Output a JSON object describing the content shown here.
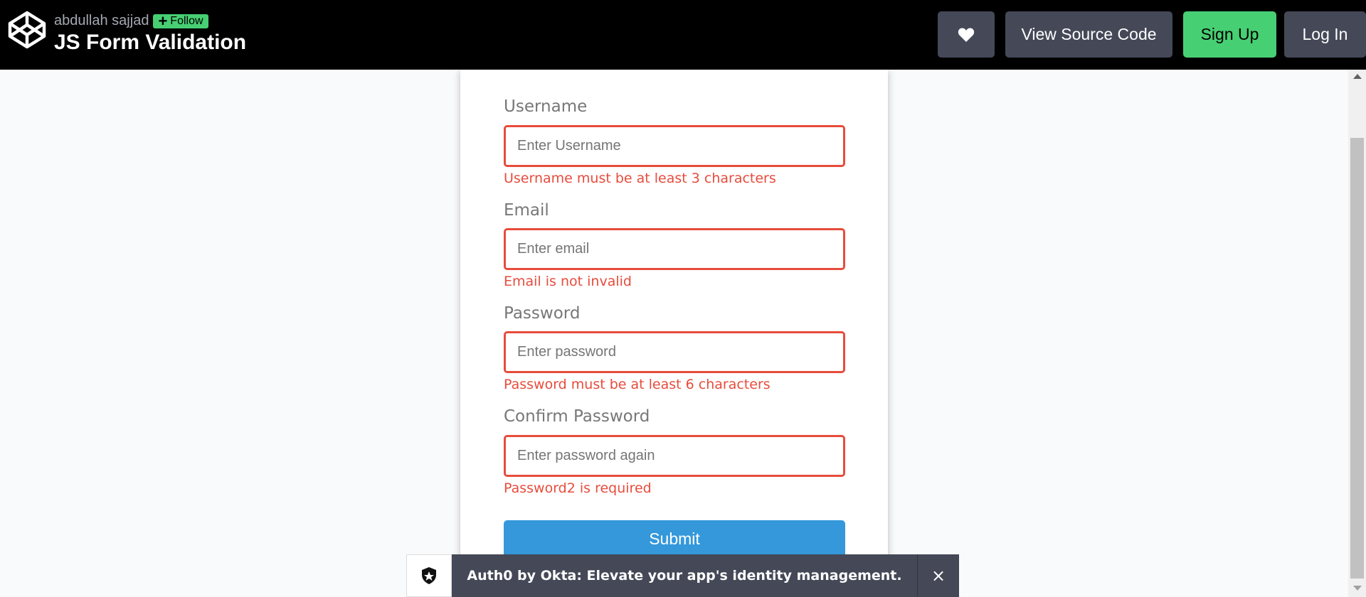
{
  "header": {
    "author": "abdullah sajjad",
    "follow_label": "Follow",
    "pen_title": "JS Form Validation",
    "source_label": "View Source Code",
    "signup_label": "Sign Up",
    "login_label": "Log In"
  },
  "form": {
    "fields": [
      {
        "label": "Username",
        "placeholder": "Enter Username",
        "error": "Username must be at least 3 characters"
      },
      {
        "label": "Email",
        "placeholder": "Enter email",
        "error": "Email is not invalid"
      },
      {
        "label": "Password",
        "placeholder": "Enter password",
        "error": "Password must be at least 6 characters"
      },
      {
        "label": "Confirm Password",
        "placeholder": "Enter password again",
        "error": "Password2 is required"
      }
    ],
    "submit_label": "Submit"
  },
  "ad": {
    "text": "Auth0 by Okta: Elevate your app's identity management.",
    "close_glyph": "×"
  },
  "colors": {
    "error": "#e74c3c",
    "submit": "#3498db",
    "accent_green": "#47cf73",
    "dark_button": "#444857"
  },
  "icons": [
    "codepen-logo-icon",
    "plus-icon",
    "heart-icon",
    "shield-icon",
    "close-icon"
  ]
}
